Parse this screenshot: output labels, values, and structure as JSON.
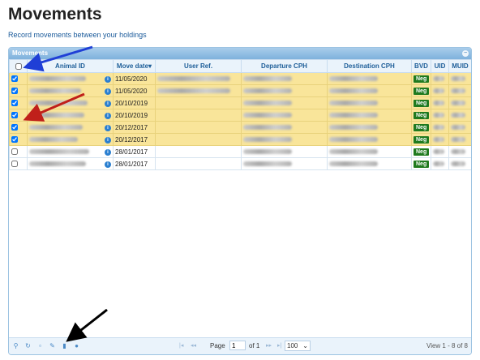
{
  "page": {
    "title": "Movements",
    "subtitle": "Record movements between your holdings"
  },
  "grid": {
    "caption": "Movements",
    "collapse_icon": "collapse-icon",
    "columns": [
      "",
      "Animal ID",
      "Move date",
      "User Ref.",
      "Departure CPH",
      "Destination CPH",
      "BVD",
      "UID",
      "MUID"
    ],
    "sort_indicator": "▾",
    "rows": [
      {
        "checked": true,
        "move_date": "11/05/2020",
        "user_ref": true,
        "bvd": "Neg"
      },
      {
        "checked": true,
        "move_date": "11/05/2020",
        "user_ref": true,
        "bvd": "Neg"
      },
      {
        "checked": true,
        "move_date": "20/10/2019",
        "user_ref": false,
        "bvd": "Neg"
      },
      {
        "checked": true,
        "move_date": "20/10/2019",
        "user_ref": false,
        "bvd": "Neg"
      },
      {
        "checked": true,
        "move_date": "20/12/2017",
        "user_ref": false,
        "bvd": "Neg"
      },
      {
        "checked": true,
        "move_date": "20/12/2017",
        "user_ref": false,
        "bvd": "Neg"
      },
      {
        "checked": false,
        "move_date": "28/01/2017",
        "user_ref": false,
        "bvd": "Neg"
      },
      {
        "checked": false,
        "move_date": "28/01/2017",
        "user_ref": false,
        "bvd": "Neg"
      }
    ]
  },
  "pager": {
    "page_label": "Page",
    "page_value": "1",
    "of_label": "of 1",
    "rows_per_page": "100",
    "view_label": "View 1 - 8 of 8",
    "tools": [
      "search-icon",
      "refresh-icon",
      "add-icon",
      "edit-icon",
      "delete-icon",
      "info-icon"
    ]
  },
  "colors": {
    "selected_row": "#f9e59a",
    "header": "#eaf3fb",
    "neg_badge": "#1f7a1f",
    "arrow_blue": "#1f3fd6",
    "arrow_red": "#c0201a",
    "arrow_black": "#000000"
  }
}
